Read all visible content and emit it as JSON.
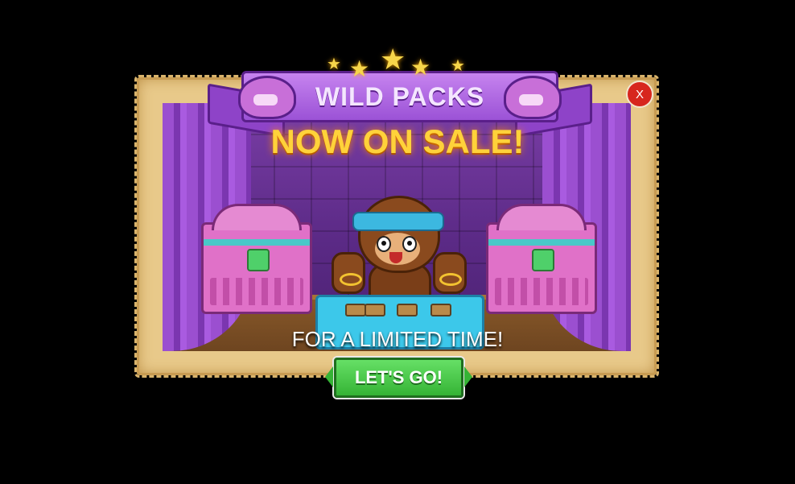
{
  "popup": {
    "banner_title": "WILD PACKS",
    "headline": "NOW ON SALE!",
    "subtext": "FOR A LIMITED TIME!",
    "cta_label": "LET'S GO!",
    "close_label": "X"
  },
  "colors": {
    "headline": "#ffd23a",
    "banner": "#9b52d6",
    "cta": "#35b335",
    "close": "#d7261e",
    "parchment": "#e8c98a"
  },
  "icons": [
    "star-icon",
    "jester-icon",
    "chest-icon",
    "monkey-character",
    "close-icon"
  ]
}
